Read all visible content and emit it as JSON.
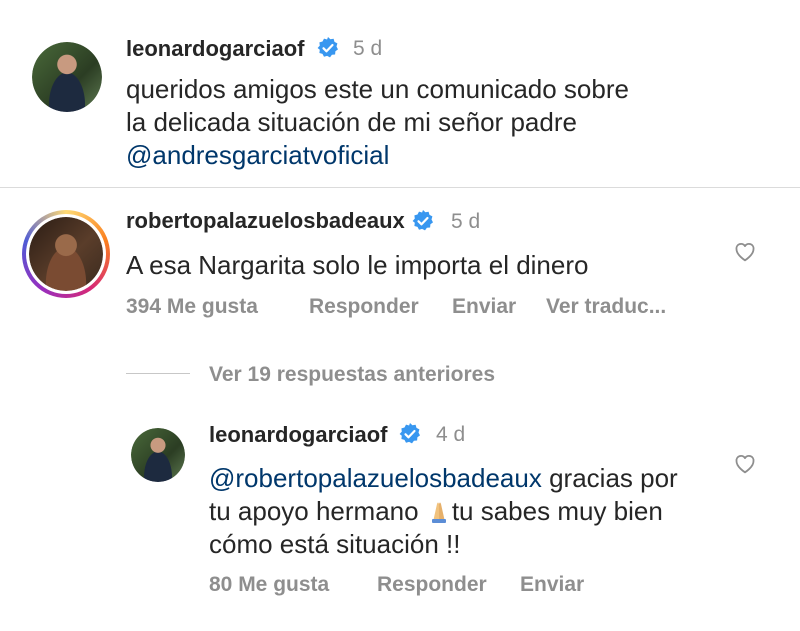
{
  "post": {
    "username": "leonardogarciaof",
    "time": "5 d",
    "caption_line1": "queridos amigos este un comunicado sobre",
    "caption_line2": "la delicada situación de mi señor padre",
    "caption_mention": "@andresgarciatvoficial"
  },
  "comment": {
    "username": "robertopalazuelosbadeaux",
    "time": "5 d",
    "text": "A esa Nargarita solo le importa el dinero",
    "likes": "394 Me gusta",
    "reply_label": "Responder",
    "send_label": "Enviar",
    "translate_label": "Ver traduc..."
  },
  "view_replies": "Ver 19 respuestas anteriores",
  "reply": {
    "username": "leonardogarciaof",
    "time": "4 d",
    "mention": "@robertopalazuelosbadeaux",
    "text_after_mention": " gracias por",
    "line2_a": "tu apoyo hermano ",
    "line2_b": "tu sabes muy bien",
    "line3": "cómo está situación !!",
    "likes": "80 Me gusta",
    "reply_label": "Responder",
    "send_label": "Enviar"
  },
  "colors": {
    "verified": "#3897f0",
    "mention": "#00376b",
    "secondary": "#8e8e8e"
  },
  "icons": {
    "verified": "verified-badge-icon",
    "heart": "heart-outline-icon",
    "emoji": "folded-hands-emoji"
  }
}
